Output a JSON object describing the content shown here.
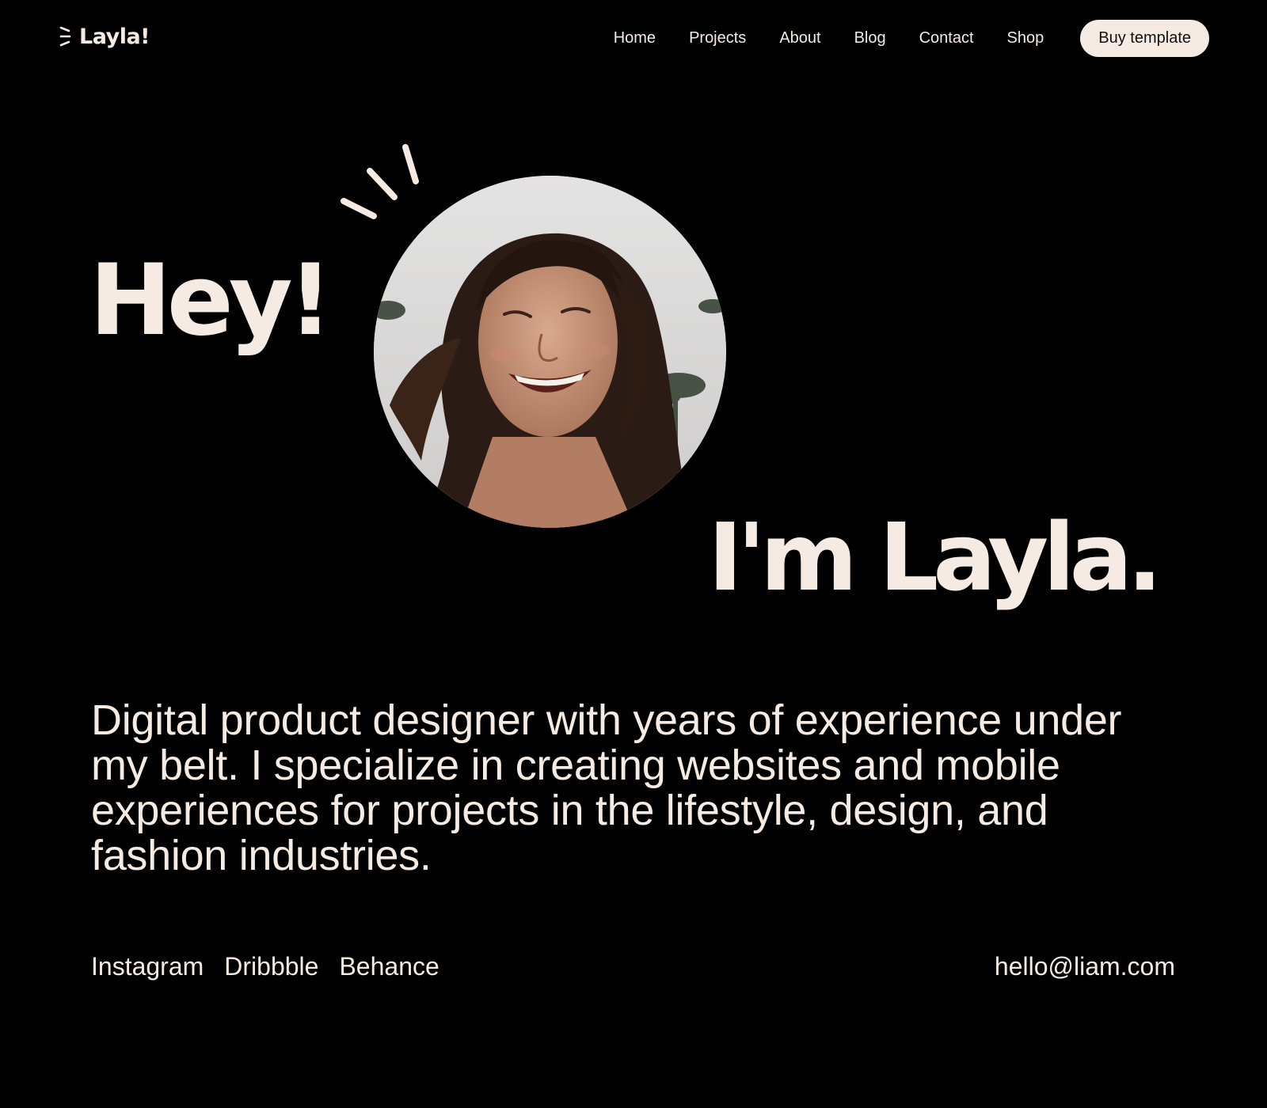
{
  "colors": {
    "background": "#000000",
    "text": "#f5ebe3",
    "button_bg": "#f5ebe3",
    "button_text": "#111111"
  },
  "header": {
    "logo_text": "Layla!",
    "logo_icon": "sparkle-lines-icon",
    "nav": [
      {
        "label": "Home"
      },
      {
        "label": "Projects"
      },
      {
        "label": "About"
      },
      {
        "label": "Blog"
      },
      {
        "label": "Contact"
      },
      {
        "label": "Shop"
      }
    ],
    "cta_label": "Buy template"
  },
  "hero": {
    "greeting": "Hey!",
    "name_line": "I'm Layla.",
    "sparkle_icon": "sparkle-lines-icon",
    "photo": "portrait of smiling woman with dark hair"
  },
  "bio": {
    "text": "Digital product designer with years of experience under my belt. I specialize in creating websites and mobile experiences for projects in the lifestyle, design, and fashion industries."
  },
  "footer": {
    "social_links": [
      {
        "label": "Instagram"
      },
      {
        "label": "Dribbble"
      },
      {
        "label": "Behance"
      }
    ],
    "email": "hello@liam.com"
  }
}
